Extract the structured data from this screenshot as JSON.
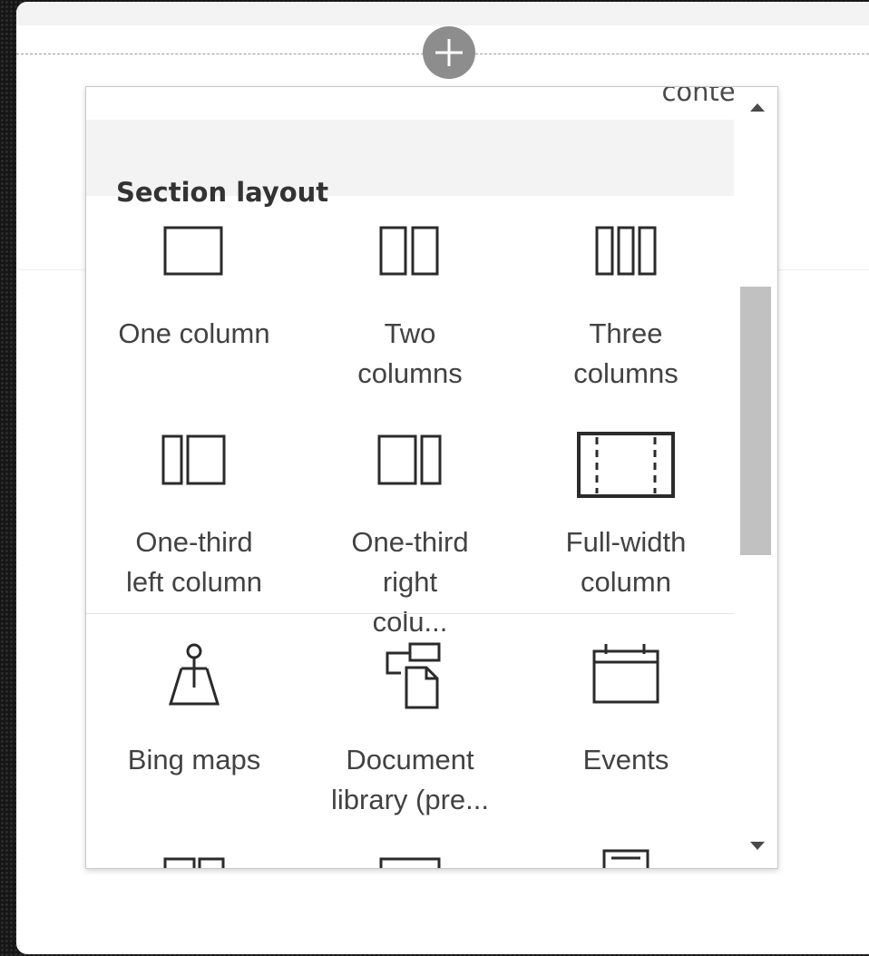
{
  "canvas": {
    "add_section_icon": "plus-circle-icon"
  },
  "toolbox": {
    "partial_item_label": "content",
    "section_layout": {
      "title": "Section layout",
      "items": [
        {
          "label": "One column",
          "icon": "one-column-icon"
        },
        {
          "label": "Two columns",
          "icon": "two-columns-icon"
        },
        {
          "label": "Three columns",
          "icon": "three-columns-icon"
        },
        {
          "label": "One-third left column",
          "icon": "one-third-left-column-icon"
        },
        {
          "label": "One-third right colu...",
          "icon": "one-third-right-column-icon"
        },
        {
          "label": "Full-width column",
          "icon": "full-width-column-icon"
        }
      ]
    },
    "web_parts": {
      "items": [
        {
          "label": "Bing maps",
          "icon": "bing-maps-icon"
        },
        {
          "label": "Document library (pre...",
          "icon": "document-library-icon"
        },
        {
          "label": "Events",
          "icon": "events-calendar-icon"
        }
      ]
    },
    "scrollbar": {
      "up_icon": "scroll-up-arrow-icon",
      "down_icon": "scroll-down-arrow-icon"
    }
  },
  "colors": {
    "page_background": "#161616",
    "canvas": "#ffffff",
    "header_band": "#f3f3f3",
    "text": "#424242",
    "icon_stroke": "#2b2b2b",
    "add_button": "#8d8d8d"
  }
}
